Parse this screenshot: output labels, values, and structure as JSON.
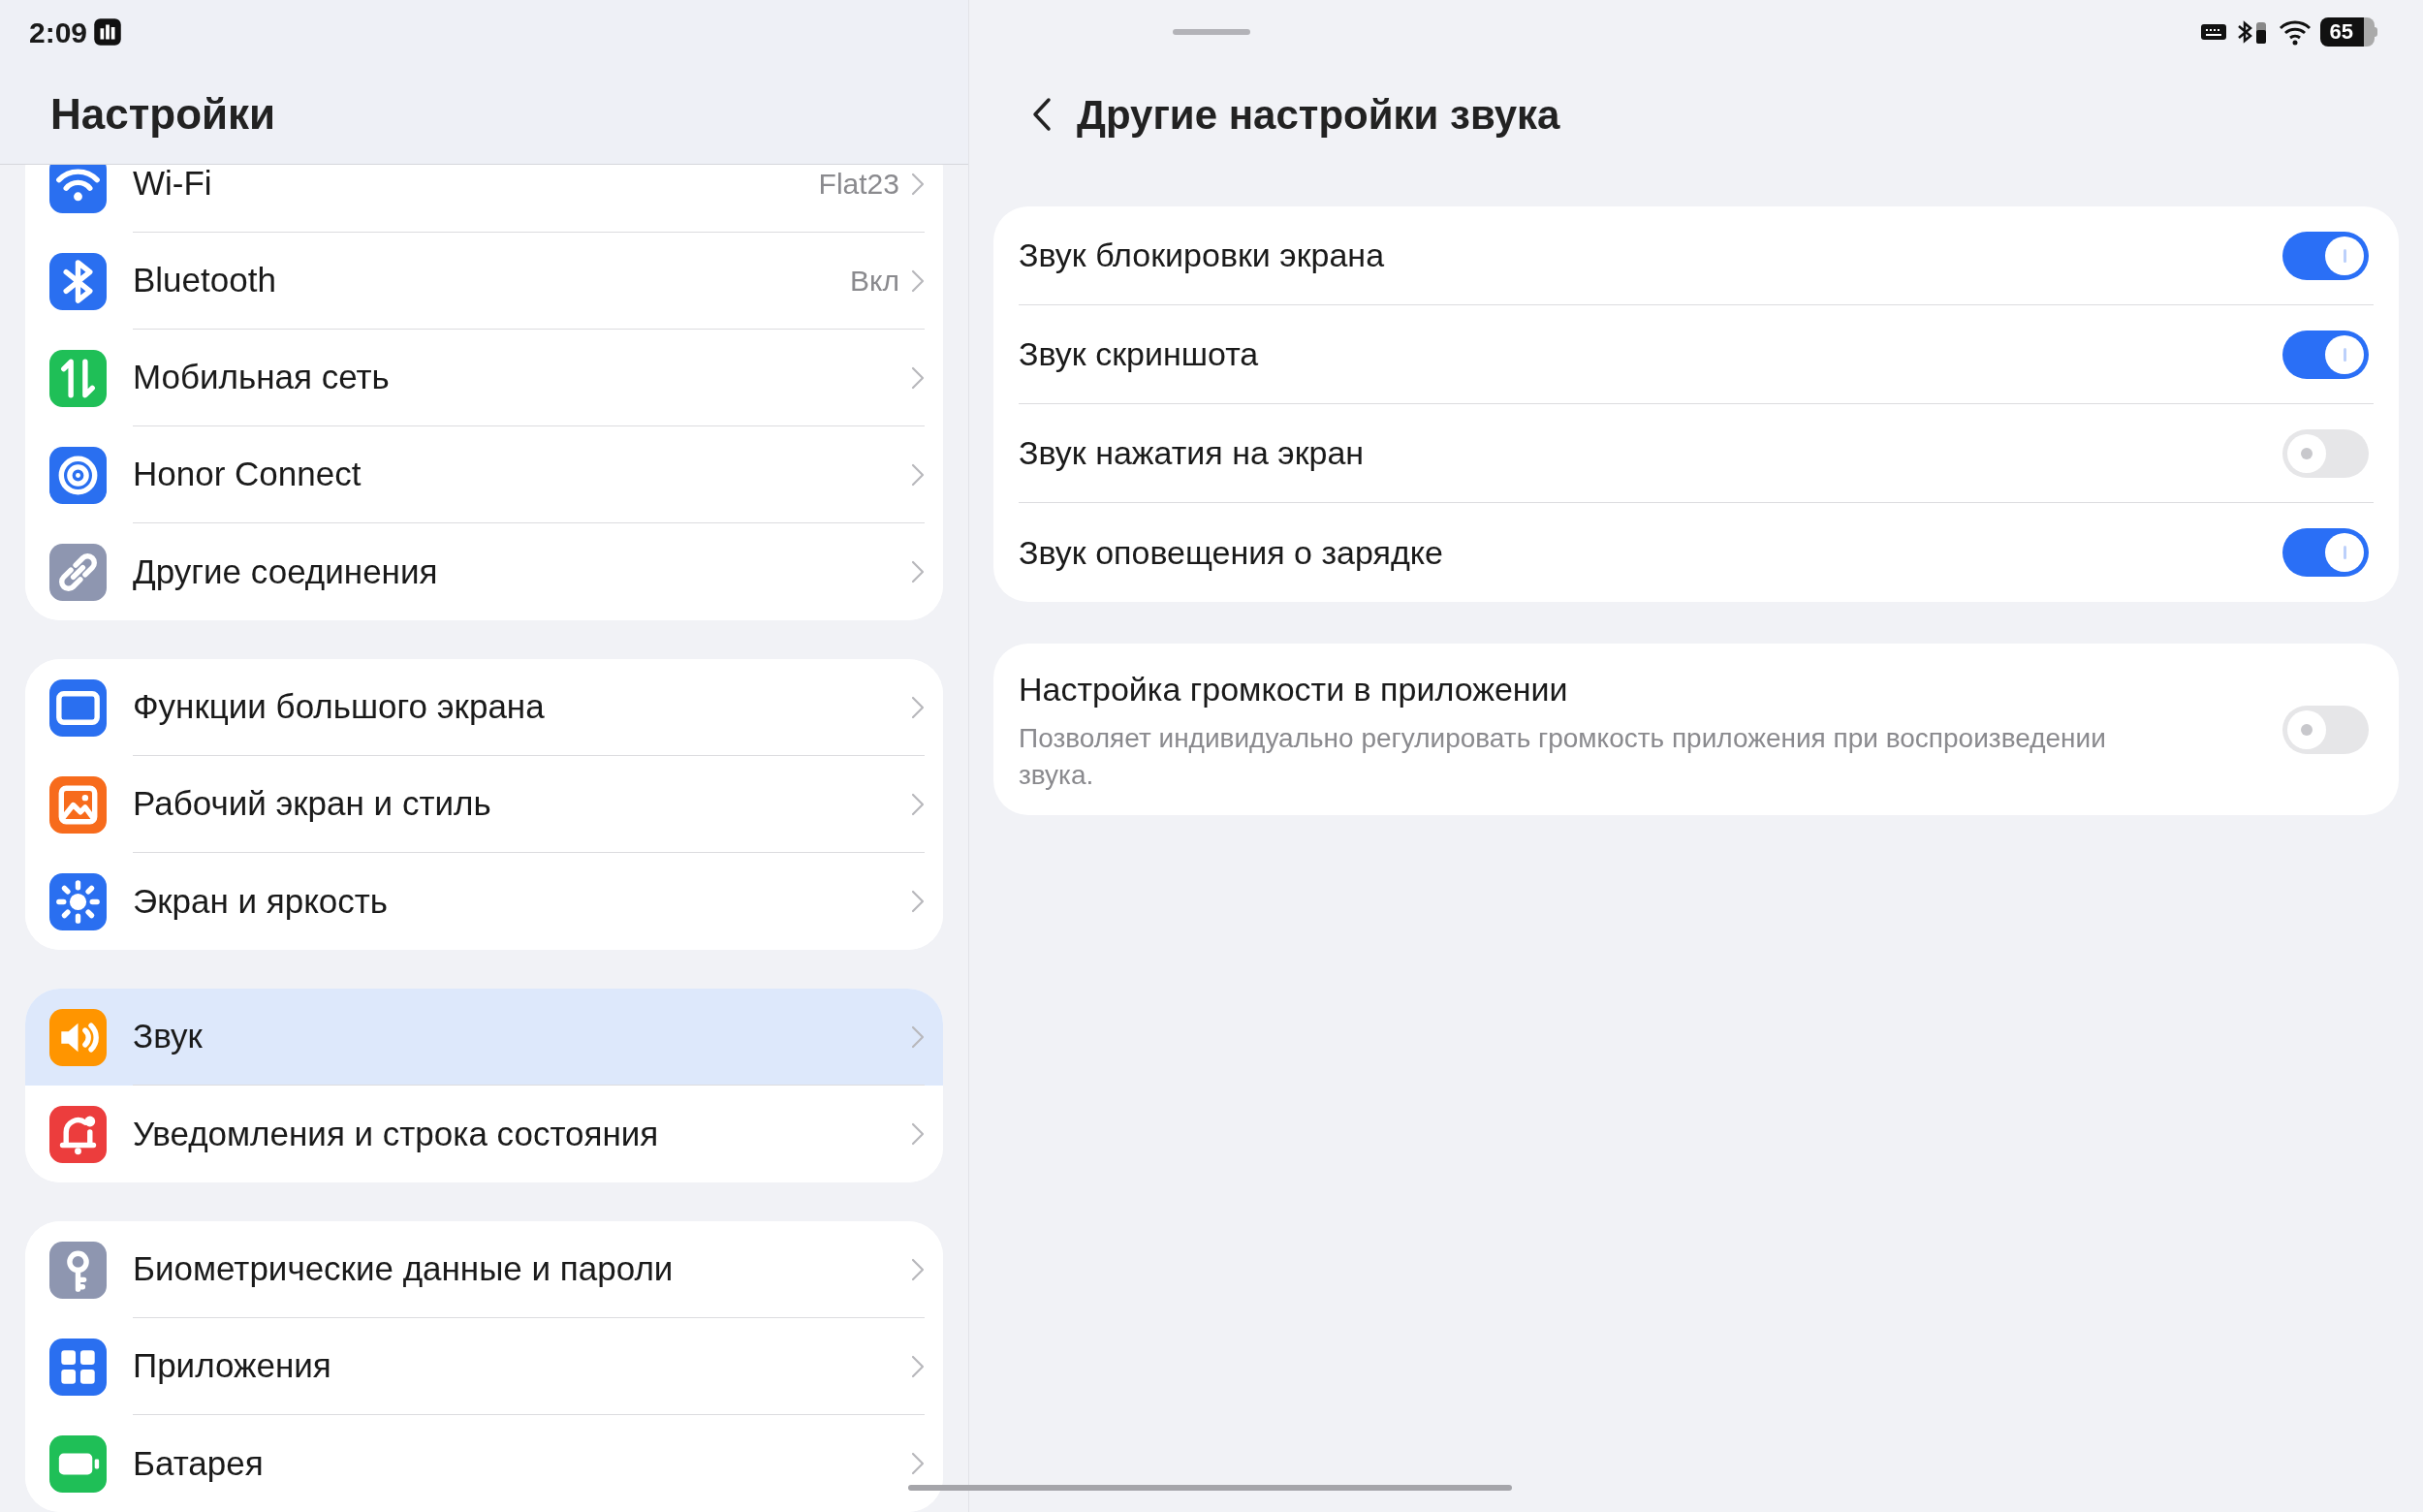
{
  "status_bar": {
    "time": "2:09",
    "battery": "65"
  },
  "sidebar": {
    "title": "Настройки",
    "groups": [
      {
        "items": [
          {
            "label": "Wi-Fi",
            "value": "Flat23",
            "selected": false
          },
          {
            "label": "Bluetooth",
            "value": "Вкл",
            "selected": false
          },
          {
            "label": "Мобильная сеть",
            "selected": false
          },
          {
            "label": "Honor Connect",
            "selected": false
          },
          {
            "label": "Другие соединения",
            "selected": false
          }
        ]
      },
      {
        "items": [
          {
            "label": "Функции большого экрана",
            "selected": false
          },
          {
            "label": "Рабочий экран и стиль",
            "selected": false
          },
          {
            "label": "Экран и яркость",
            "selected": false
          }
        ]
      },
      {
        "items": [
          {
            "label": "Звук",
            "selected": true
          },
          {
            "label": "Уведомления и строка состояния",
            "selected": false
          }
        ]
      },
      {
        "items": [
          {
            "label": "Биометрические данные и пароли",
            "selected": false
          },
          {
            "label": "Приложения",
            "selected": false
          },
          {
            "label": "Батарея",
            "selected": false
          }
        ]
      }
    ]
  },
  "page": {
    "title": "Другие настройки звука",
    "cards": [
      {
        "rows": [
          {
            "label": "Звук блокировки экрана",
            "on": true
          },
          {
            "label": "Звук скриншота",
            "on": true
          },
          {
            "label": "Звук нажатия на экран",
            "on": false
          },
          {
            "label": "Звук оповещения о зарядке",
            "on": true
          }
        ]
      },
      {
        "rows": [
          {
            "label": "Настройка громкости в приложении",
            "description": "Позволяет индивидуально регулировать громкость приложения при воспроизведении звука.",
            "on": false
          }
        ]
      }
    ]
  }
}
